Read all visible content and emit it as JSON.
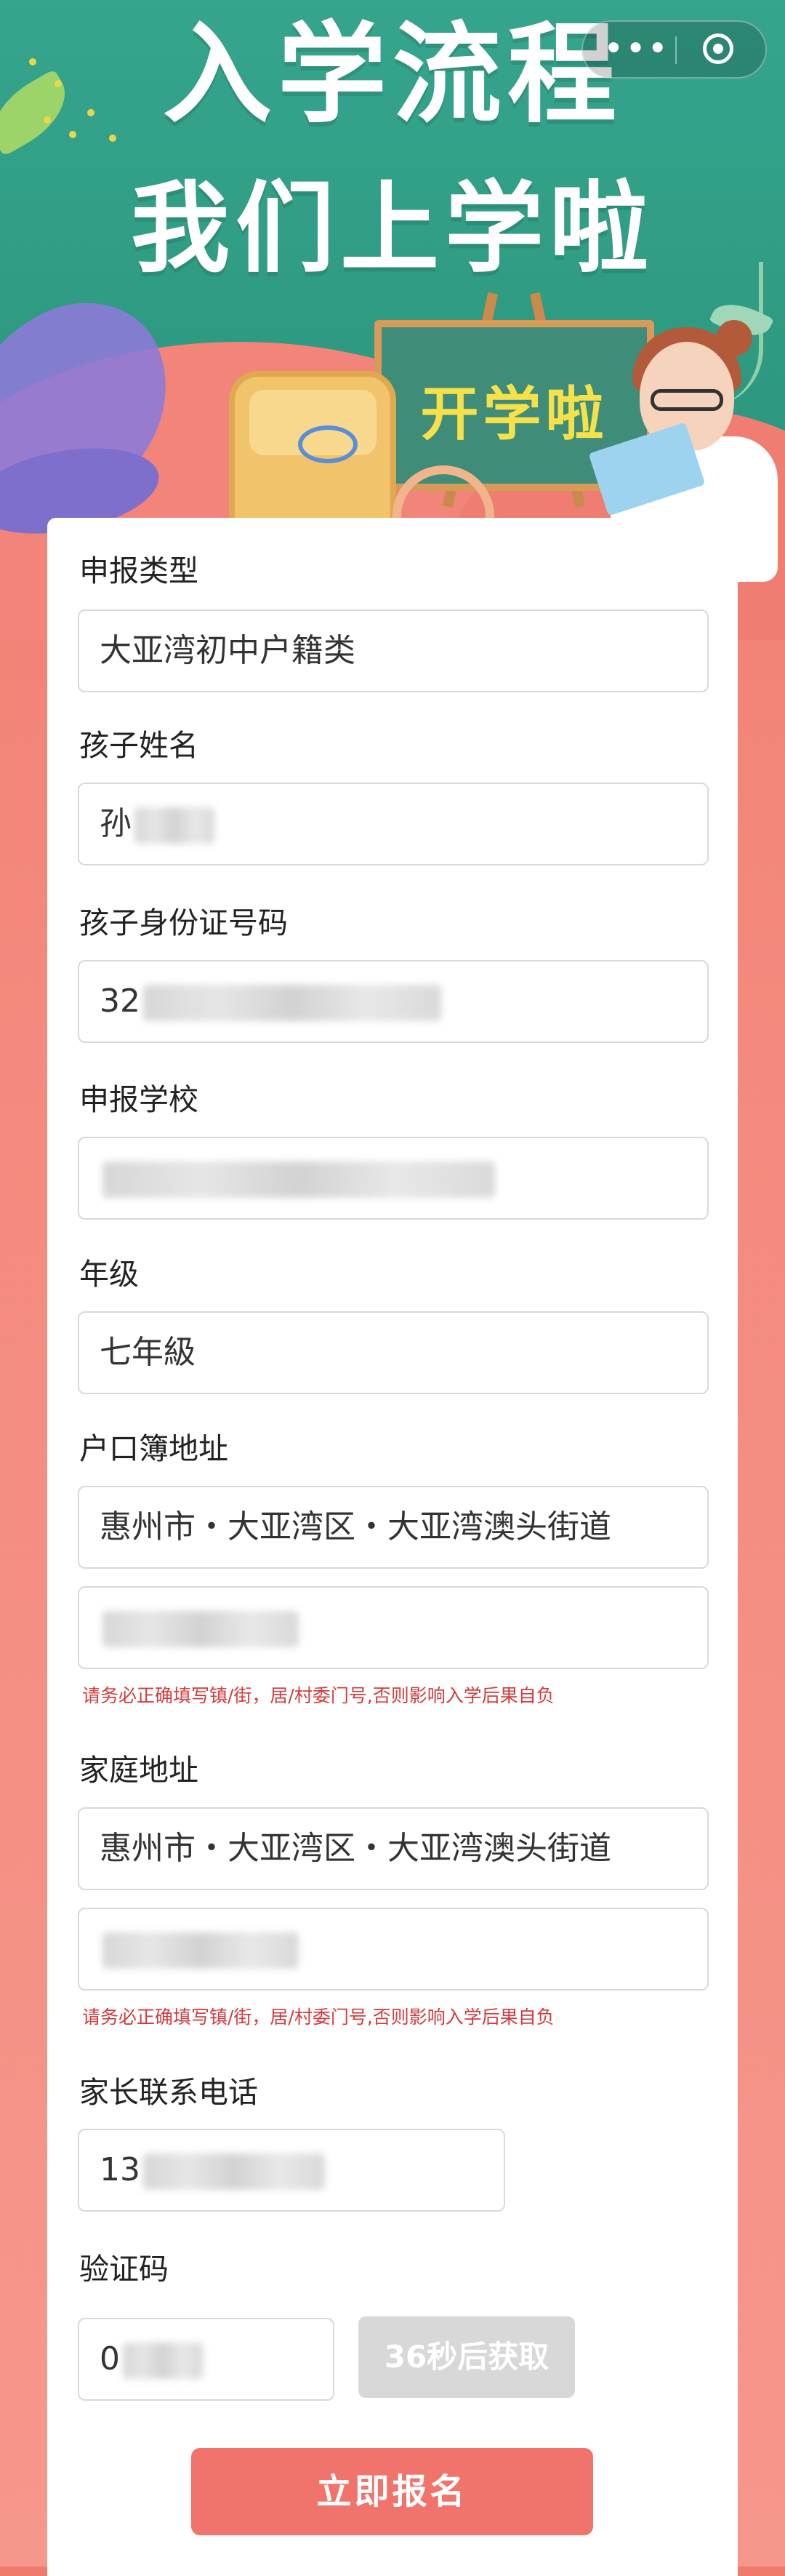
{
  "hero": {
    "title_line1": "入学流程",
    "title_line2": "我们上学啦",
    "board_text": "开学啦"
  },
  "capsule": {
    "more_icon": "more-dots-icon",
    "close_icon": "close-circle-icon"
  },
  "form": {
    "type": {
      "label": "申报类型",
      "value": "大亚湾初中户籍类"
    },
    "child_name": {
      "label": "孩子姓名",
      "value": "孙"
    },
    "child_id": {
      "label": "孩子身份证号码",
      "value": "32"
    },
    "school": {
      "label": "申报学校",
      "value": ""
    },
    "grade": {
      "label": "年级",
      "value": "七年級"
    },
    "hukou": {
      "label": "户口簿地址",
      "region": "惠州市・大亚湾区・大亚湾澳头街道",
      "detail": "",
      "warning": "请务必正确填写镇/街，居/村委门号,否则影响入学后果自负"
    },
    "home": {
      "label": "家庭地址",
      "region": "惠州市・大亚湾区・大亚湾澳头街道",
      "detail": "",
      "warning": "请务必正确填写镇/街，居/村委门号,否则影响入学后果自负"
    },
    "phone": {
      "label": "家长联系电话",
      "value": "13"
    },
    "code": {
      "label": "验证码",
      "value": "0",
      "button": "36秒后获取"
    },
    "submit": "立即报名"
  },
  "colors": {
    "accent": "#f0746b",
    "hero_green": "#2f9a82",
    "warning": "#d23b3b",
    "disabled_button": "#d8d8d8"
  }
}
